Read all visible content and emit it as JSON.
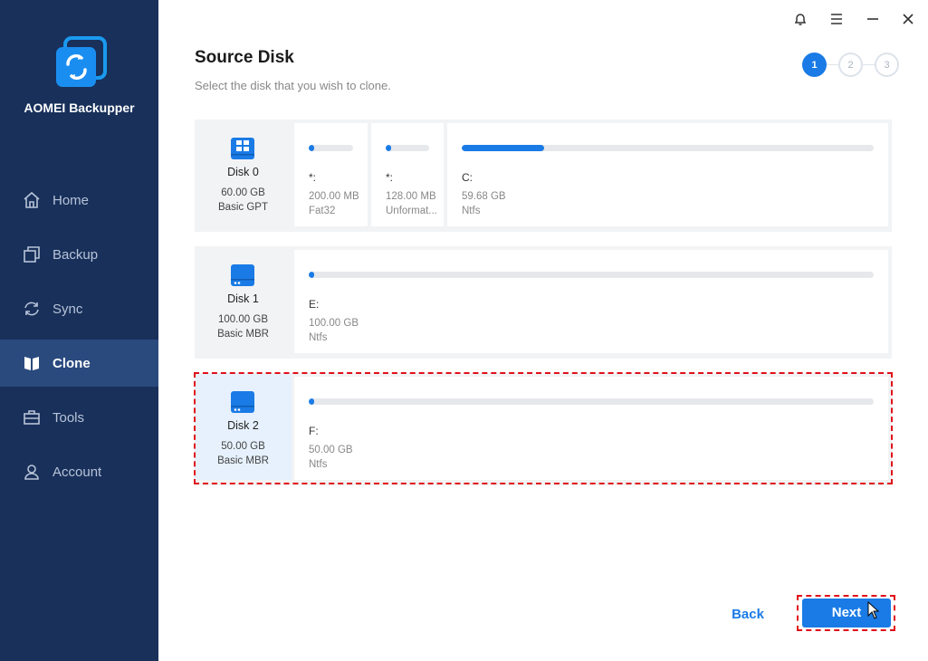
{
  "app": {
    "name": "AOMEI Backupper"
  },
  "sidebar": {
    "items": [
      {
        "label": "Home",
        "icon": "home-icon",
        "active": false
      },
      {
        "label": "Backup",
        "icon": "backup-icon",
        "active": false
      },
      {
        "label": "Sync",
        "icon": "sync-icon",
        "active": false
      },
      {
        "label": "Clone",
        "icon": "clone-icon",
        "active": true
      },
      {
        "label": "Tools",
        "icon": "tools-icon",
        "active": false
      },
      {
        "label": "Account",
        "icon": "account-icon",
        "active": false
      }
    ]
  },
  "window_controls": [
    "bell-icon",
    "menu-icon",
    "minimize-icon",
    "close-icon"
  ],
  "header": {
    "title": "Source Disk",
    "subtitle": "Select the disk that you wish to clone."
  },
  "steps": {
    "labels": [
      "1",
      "2",
      "3"
    ],
    "current": 1
  },
  "disks": [
    {
      "name": "Disk 0",
      "size": "60.00 GB",
      "type": "Basic GPT",
      "icon": "windows-disk-icon",
      "selected": false,
      "partitions": [
        {
          "letter": "*:",
          "size": "200.00 MB",
          "fs": "Fat32",
          "usage": 0.02
        },
        {
          "letter": "*:",
          "size": "128.00 MB",
          "fs": "Unformatted",
          "fs_display": "Unformat...",
          "usage": 0.02
        },
        {
          "letter": "C:",
          "size": "59.68 GB",
          "fs": "Ntfs",
          "usage": 0.2
        }
      ]
    },
    {
      "name": "Disk 1",
      "size": "100.00 GB",
      "type": "Basic MBR",
      "icon": "disk-icon",
      "selected": false,
      "partitions": [
        {
          "letter": "E:",
          "size": "100.00 GB",
          "fs": "Ntfs",
          "usage": 0.005
        }
      ]
    },
    {
      "name": "Disk 2",
      "size": "50.00 GB",
      "type": "Basic MBR",
      "icon": "disk-icon",
      "selected": true,
      "partitions": [
        {
          "letter": "F:",
          "size": "50.00 GB",
          "fs": "Ntfs",
          "usage": 0.005
        }
      ]
    }
  ],
  "footer": {
    "back_label": "Back",
    "next_label": "Next"
  },
  "colors": {
    "sidebar": "#18305a",
    "sidebar_active": "#2a4a7e",
    "accent": "#1a7be6",
    "highlight": "#e0101b"
  }
}
